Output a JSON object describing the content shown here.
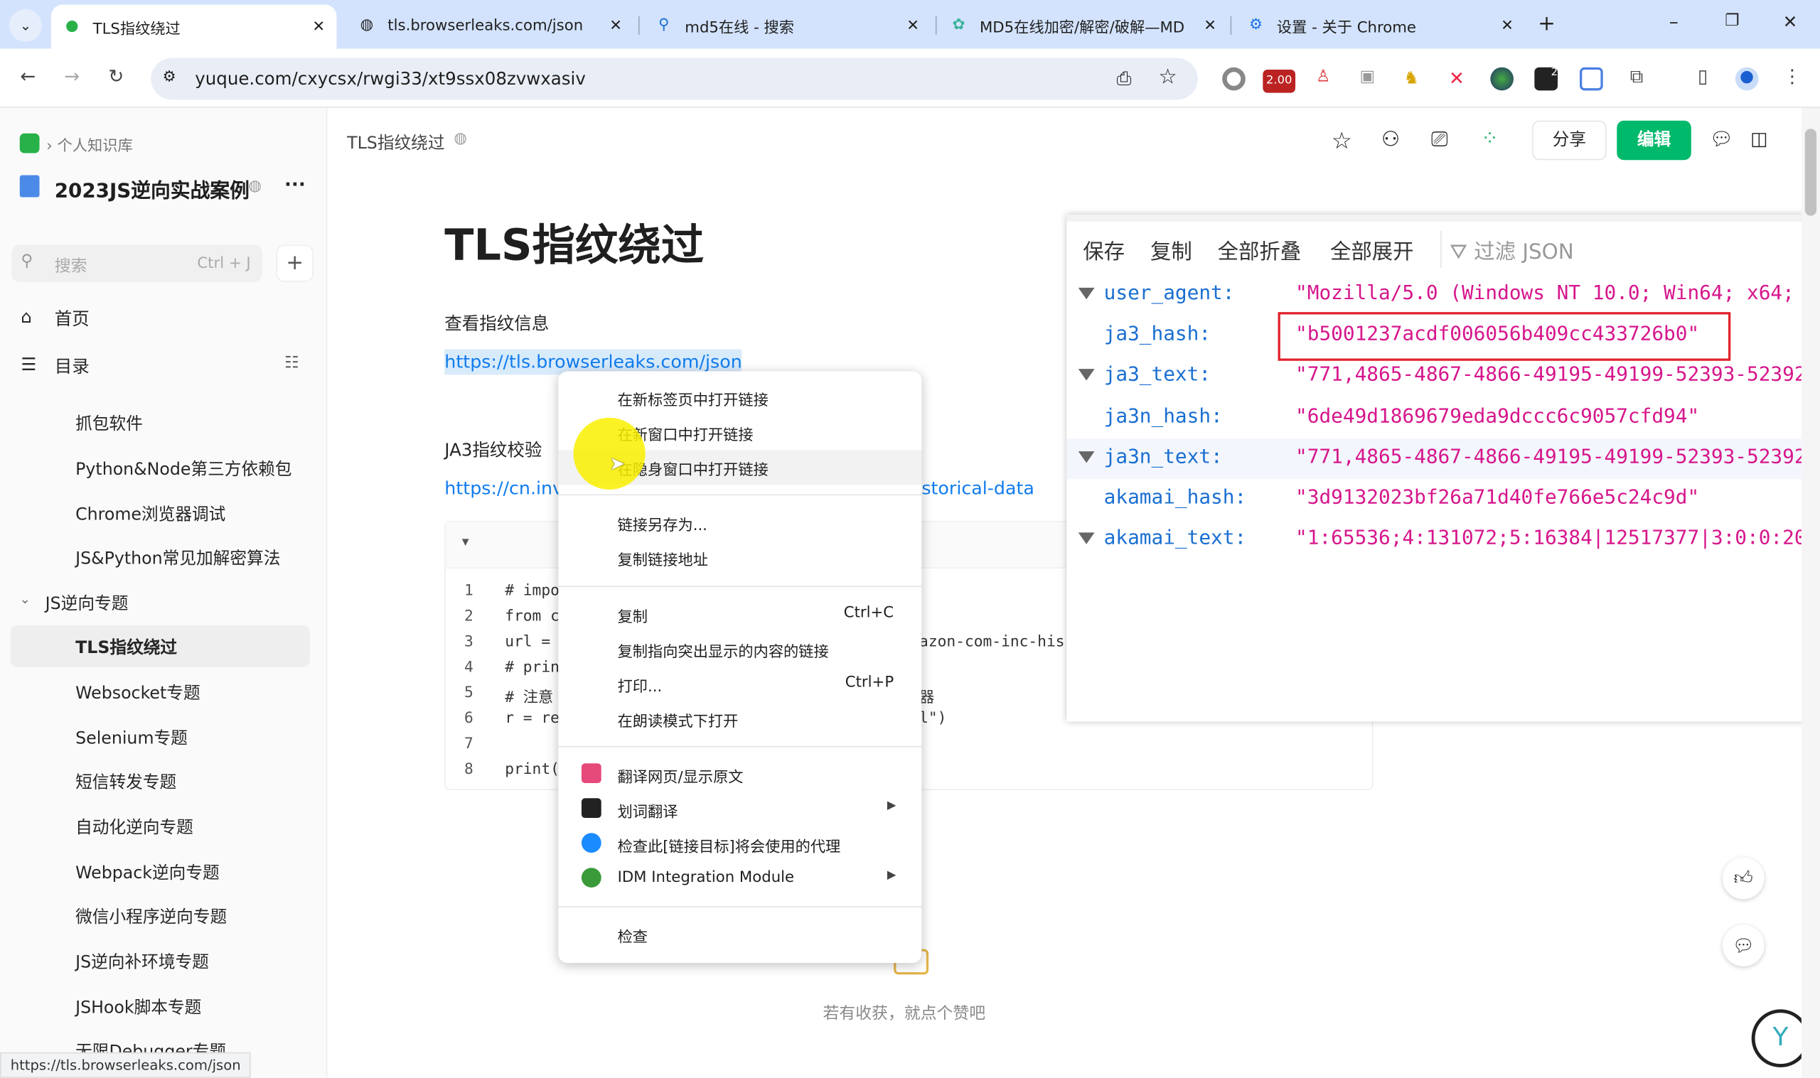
{
  "browser": {
    "tabs": [
      {
        "title": "TLS指纹绕过",
        "active": true,
        "icon": "yuque-icon"
      },
      {
        "title": "tls.browserleaks.com/json",
        "icon": "globe-icon"
      },
      {
        "title": "md5在线 - 搜索",
        "icon": "search-icon"
      },
      {
        "title": "MD5在线加密/解密/破解—MD",
        "icon": "gear-green-icon"
      },
      {
        "title": "设置 - 关于 Chrome",
        "icon": "settings-icon"
      }
    ],
    "url": "yuque.com/cxycsx/rwgi33/xt9ssx08zvwxasiv",
    "extension_badge": "2.00",
    "extension_badge2": "2",
    "status_url": "https://tls.browserleaks.com/json"
  },
  "sidebar": {
    "breadcrumb": "个人知识库",
    "book_title": "2023JS逆向实战案例",
    "search_placeholder": "搜索",
    "search_shortcut": "Ctrl + J",
    "home": "首页",
    "toc": "目录",
    "items": [
      "抓包软件",
      "Python&Node第三方依赖包",
      "Chrome浏览器调试",
      "JS&Python常见加解密算法"
    ],
    "group": "JS逆向专题",
    "group_items": [
      "TLS指纹绕过",
      "Websocket专题",
      "Selenium专题",
      "短信转发专题",
      "自动化逆向专题",
      "Webpack逆向专题",
      "微信小程序逆向专题",
      "JS逆向补环境专题",
      "JSHook脚本专题",
      "无限Debugger专题"
    ],
    "selected": "TLS指纹绕过"
  },
  "header": {
    "doc_title": "TLS指纹绕过",
    "share": "分享",
    "edit": "编辑"
  },
  "doc": {
    "title": "TLS指纹绕过",
    "p1": "查看指纹信息",
    "link1": "https://tls.browserleaks.com/json",
    "p2": "JA3指纹校验",
    "link2_start": "https://cn.inv",
    "link2_end": "storical-data",
    "code_left": [
      "# impo",
      "from c",
      "url = ",
      "# prin",
      "# 注意",
      "r = re",
      "",
      "print("
    ],
    "code_right": [
      "",
      "",
      "azon-com-inc-his",
      "",
      "器",
      "l\")",
      "",
      ""
    ],
    "like_prompt": "若有收获，就点个赞吧"
  },
  "context_menu": {
    "items": [
      {
        "label": "在新标签页中打开链接"
      },
      {
        "label": "在新窗口中打开链接"
      },
      {
        "label": "在隐身窗口中打开链接",
        "highlighted": true
      },
      {
        "label": "链接另存为..."
      },
      {
        "label": "复制链接地址"
      },
      {
        "label": "复制",
        "shortcut": "Ctrl+C"
      },
      {
        "label": "复制指向突出显示的内容的链接"
      },
      {
        "label": "打印...",
        "shortcut": "Ctrl+P"
      },
      {
        "label": "在朗读模式下打开"
      },
      {
        "label": "翻译网页/显示原文",
        "icon": "translate-icon"
      },
      {
        "label": "划词翻译",
        "icon": "word-translate-icon",
        "submenu": true
      },
      {
        "label": "检查此[链接目标]将会使用的代理",
        "icon": "proxy-icon"
      },
      {
        "label": "IDM Integration Module",
        "icon": "idm-icon",
        "submenu": true
      },
      {
        "label": "检查"
      }
    ]
  },
  "json_viewer": {
    "toolbar": [
      "保存",
      "复制",
      "全部折叠",
      "全部展开"
    ],
    "filter_placeholder": "过滤 JSON",
    "rows": [
      {
        "key": "user_agent:",
        "value": "\"Mozilla/5.0 (Windows NT 10.0; Win64; x64;",
        "collapsible": true
      },
      {
        "key": "ja3_hash:",
        "value": "\"b5001237acdf006056b409cc433726b0\"",
        "highlighted_box": true
      },
      {
        "key": "ja3_text:",
        "value": "\"771,4865-4867-4866-49195-49199-52393-52392",
        "collapsible": true
      },
      {
        "key": "ja3n_hash:",
        "value": "\"6de49d1869679eda9dccc6c9057cfd94\""
      },
      {
        "key": "ja3n_text:",
        "value": "\"771,4865-4867-4866-49195-49199-52393-52392",
        "collapsible": true,
        "hovered": true
      },
      {
        "key": "akamai_hash:",
        "value": "\"3d9132023bf26a71d40fe766e5c24c9d\""
      },
      {
        "key": "akamai_text:",
        "value": "\"1:65536;4:131072;5:16384|12517377|3:0:0:20",
        "collapsible": true
      }
    ]
  },
  "colors": {
    "accent_green": "#00b96b",
    "json_key": "#1a6fd1",
    "json_value": "#d6168c",
    "highlight_box": "#e0202a",
    "link": "#117cee"
  }
}
